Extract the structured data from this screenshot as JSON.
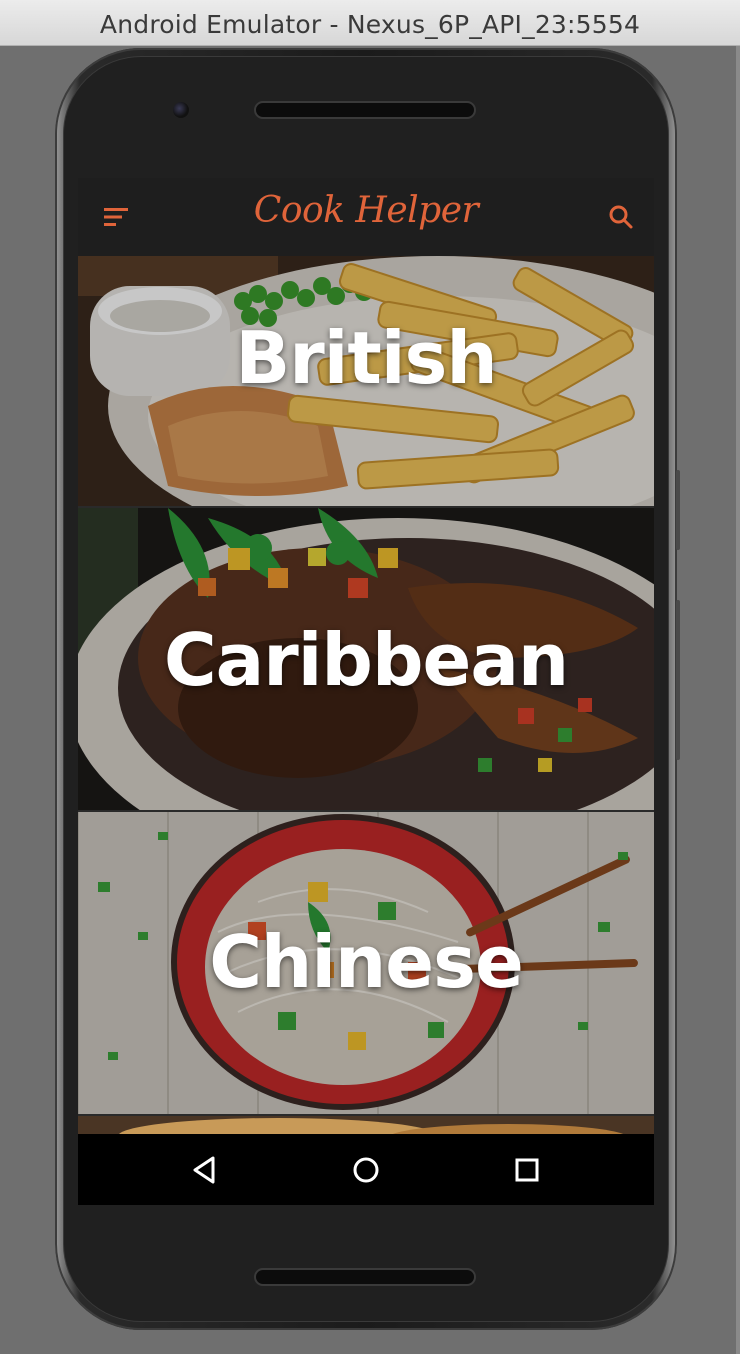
{
  "window": {
    "title": "Android Emulator - Nexus_6P_API_23:5554"
  },
  "app": {
    "title": "Cook Helper",
    "accent_color": "#e0643a",
    "menu_icon": "menu-lines-icon",
    "search_icon": "search-icon"
  },
  "cuisines": [
    {
      "label": "British"
    },
    {
      "label": "Caribbean"
    },
    {
      "label": "Chinese"
    }
  ],
  "navbar": {
    "back_icon": "back-triangle-icon",
    "home_icon": "home-circle-icon",
    "recents_icon": "recents-square-icon"
  }
}
